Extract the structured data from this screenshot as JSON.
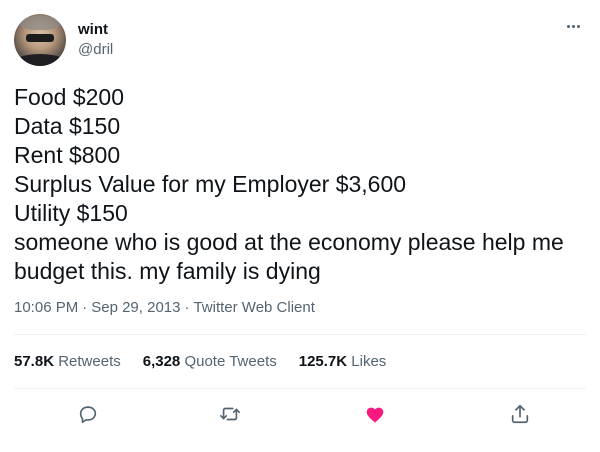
{
  "author": {
    "display_name": "wint",
    "handle": "@dril",
    "avatar_icon": "avatar-photo"
  },
  "menu_icon": "more-horizontal-icon",
  "tweet": {
    "lines": [
      "Food $200",
      "Data $150",
      "Rent $800",
      "Surplus Value for my Employer $3,600",
      "Utility $150",
      "someone who is good at the economy please help me",
      "budget this. my family is dying"
    ]
  },
  "meta": {
    "time": "10:06 PM",
    "separator": "·",
    "date": "Sep 29, 2013",
    "source": "Twitter Web Client"
  },
  "stats": {
    "retweets_count": "57.8K",
    "retweets_label": "Retweets",
    "quotes_count": "6,328",
    "quotes_label": "Quote Tweets",
    "likes_count": "125.7K",
    "likes_label": "Likes"
  },
  "actions": {
    "reply_icon": "reply-icon",
    "retweet_icon": "retweet-icon",
    "like_icon": "heart-icon",
    "share_icon": "share-icon",
    "like_color": "#f91880",
    "icon_color": "#536471"
  }
}
